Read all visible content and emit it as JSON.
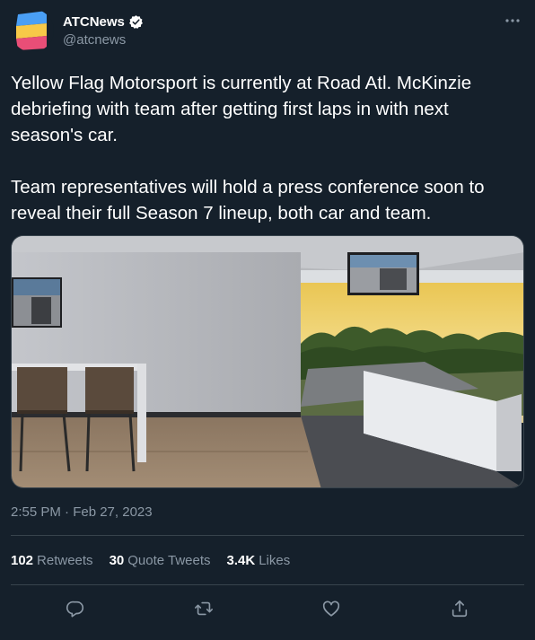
{
  "author": {
    "display_name": "ATCNews",
    "handle": "@atcnews",
    "verified": true,
    "avatar_colors": [
      "#4a9ff5",
      "#f7c948",
      "#e94e77"
    ]
  },
  "tweet": {
    "paragraphs": [
      "Yellow Flag Motorsport is currently at Road Atl. McKinzie debriefing with team after getting first laps in with next season's car.",
      "Team representatives will hold a press conference soon to reveal their full Season 7 lineup, both car and team."
    ],
    "timestamp": "2:55 PM · Feb 27, 2023"
  },
  "stats": {
    "retweets_count": "102",
    "retweets_label": "Retweets",
    "quotes_count": "30",
    "quotes_label": "Quote Tweets",
    "likes_count": "3.4K",
    "likes_label": "Likes"
  },
  "actions": [
    "reply-icon",
    "retweet-icon",
    "like-icon",
    "share-icon"
  ],
  "colors": {
    "background": "#15202b",
    "text": "#ffffff",
    "secondary": "#8b98a5",
    "border": "#38444d"
  }
}
